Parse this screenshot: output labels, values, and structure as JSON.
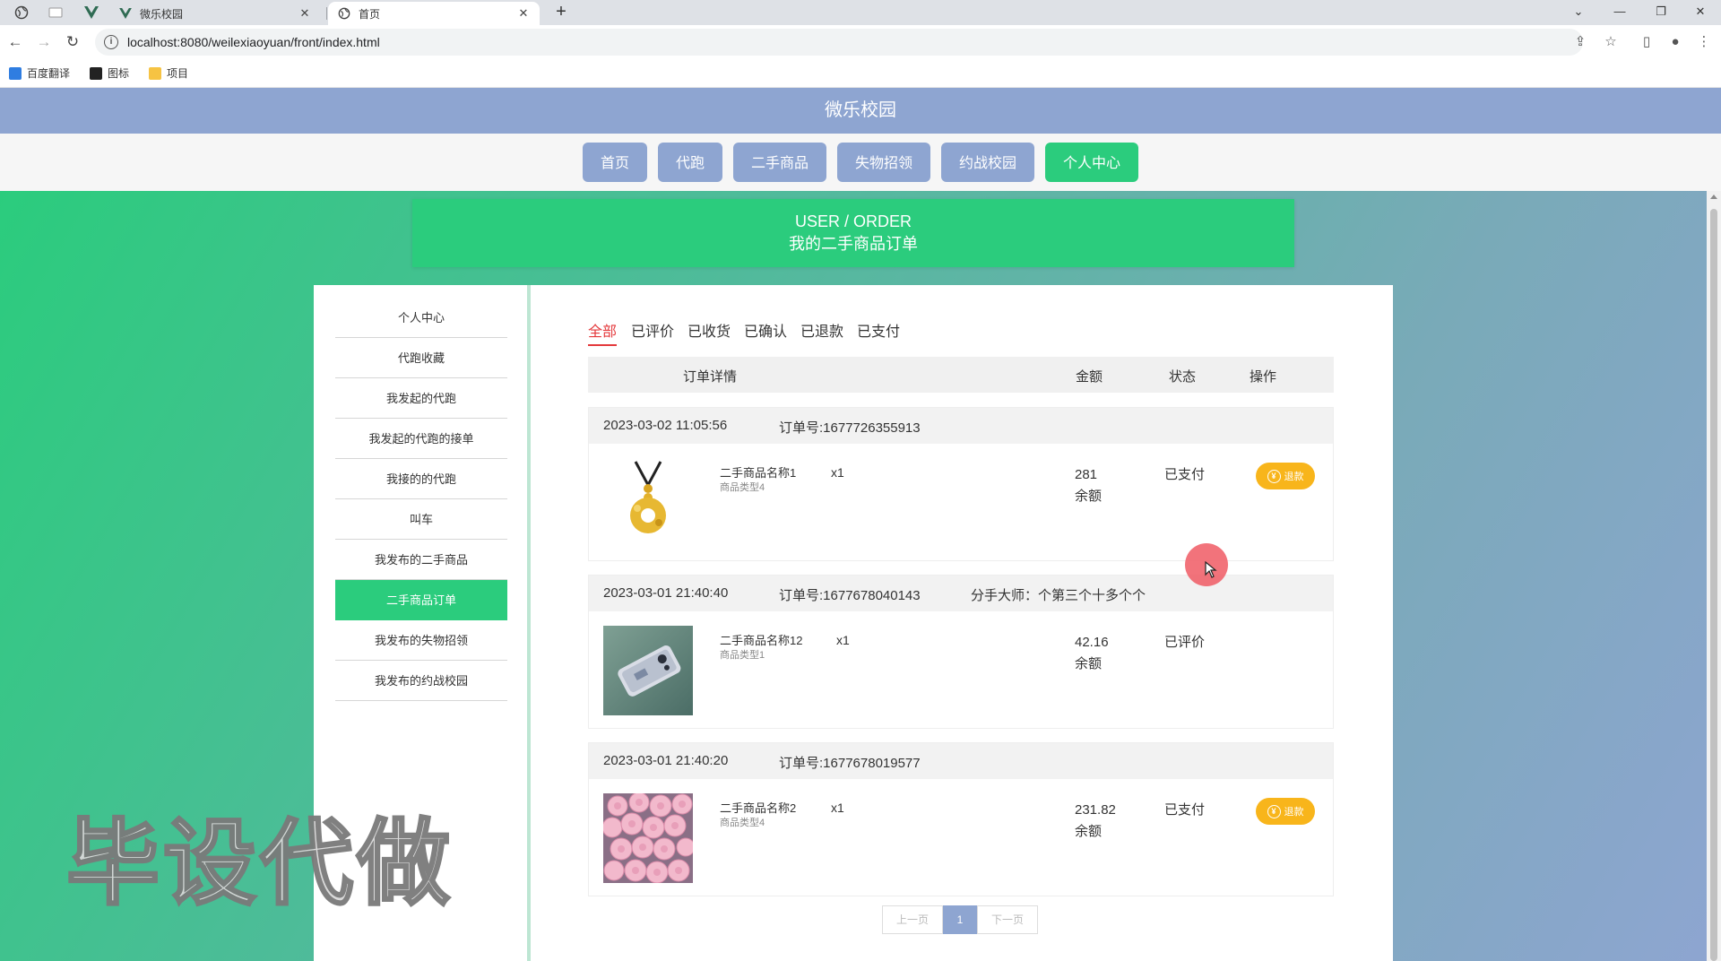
{
  "browser": {
    "tabs": [
      {
        "title": "微乐校园"
      },
      {
        "title": "首页"
      }
    ],
    "url": "localhost:8080/weilexiaoyuan/front/index.html",
    "bookmarks": [
      "百度翻译",
      "图标",
      "项目"
    ]
  },
  "site": {
    "title": "微乐校园",
    "nav": [
      "首页",
      "代跑",
      "二手商品",
      "失物招领",
      "约战校园",
      "个人中心"
    ],
    "active_nav": "个人中心"
  },
  "banner": {
    "en": "USER / ORDER",
    "cn": "我的二手商品订单"
  },
  "sidebar": {
    "items": [
      "个人中心",
      "代跑收藏",
      "我发起的代跑",
      "我发起的代跑的接单",
      "我接的的代跑",
      "叫车",
      "我发布的二手商品",
      "二手商品订单",
      "我发布的失物招领",
      "我发布的约战校园"
    ],
    "active": "二手商品订单"
  },
  "filters": {
    "tabs": [
      "全部",
      "已评价",
      "已收货",
      "已确认",
      "已退款",
      "已支付"
    ],
    "active": "全部"
  },
  "table": {
    "headers": {
      "detail": "订单详情",
      "amount": "金额",
      "status": "状态",
      "action": "操作"
    }
  },
  "orders": [
    {
      "time": "2023-03-02 11:05:56",
      "order_no": "订单号:1677726355913",
      "remark": "",
      "product_name": "二手商品名称1",
      "product_type": "商品类型4",
      "qty": "x1",
      "amount": "281",
      "pay_method": "余额",
      "status": "已支付",
      "action": "退款",
      "thumb": "pendant-image"
    },
    {
      "time": "2023-03-01 21:40:40",
      "order_no": "订单号:1677678040143",
      "remark": "分手大师：个第三个十多个个",
      "product_name": "二手商品名称12",
      "product_type": "商品类型1",
      "qty": "x1",
      "amount": "42.16",
      "pay_method": "余额",
      "status": "已评价",
      "action": "",
      "thumb": "phone-image"
    },
    {
      "time": "2023-03-01 21:40:20",
      "order_no": "订单号:1677678019577",
      "remark": "",
      "product_name": "二手商品名称2",
      "product_type": "商品类型4",
      "qty": "x1",
      "amount": "231.82",
      "pay_method": "余额",
      "status": "已支付",
      "action": "退款",
      "thumb": "roses-image"
    }
  ],
  "pager": {
    "prev": "上一页",
    "current": "1",
    "next": "下一页"
  },
  "watermark": "毕设代做"
}
